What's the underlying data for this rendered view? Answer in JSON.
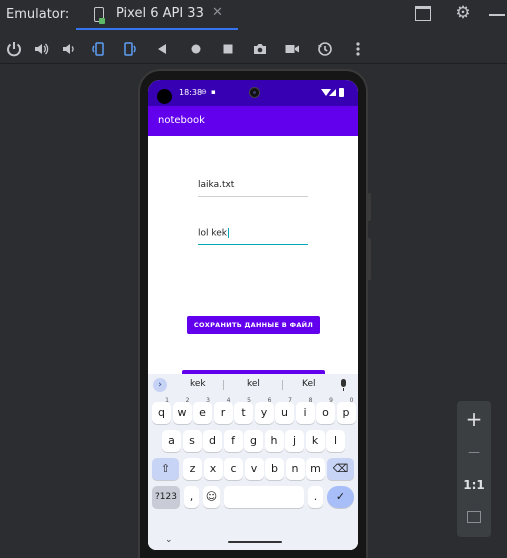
{
  "ide": {
    "panel_title": "Emulator:",
    "tab_title": "Pixel 6 API 33",
    "tab_close": "✕"
  },
  "toolbar": {
    "items": [
      "power-icon",
      "volume-up-icon",
      "volume-down-icon",
      "rotate-left-icon",
      "rotate-right-icon",
      "back-icon",
      "home-icon",
      "overview-icon",
      "screenshot-icon",
      "screen-record-icon",
      "snapshot-icon",
      "more-icon"
    ]
  },
  "device": {
    "status": {
      "time": "18:38"
    },
    "app": {
      "title": "notebook",
      "filename_value": "laika.txt",
      "content_value": "lol kek",
      "save_button": "СОХРАНИТЬ ДАННЫЕ В ФАЙЛ"
    },
    "keyboard": {
      "suggestions": [
        "kek",
        "kel",
        "Kel"
      ],
      "row1": [
        "q",
        "w",
        "e",
        "r",
        "t",
        "y",
        "u",
        "i",
        "o",
        "p"
      ],
      "row1_hints": [
        "1",
        "2",
        "3",
        "4",
        "5",
        "6",
        "7",
        "8",
        "9",
        "0"
      ],
      "row2": [
        "a",
        "s",
        "d",
        "f",
        "g",
        "h",
        "j",
        "k",
        "l"
      ],
      "row3": [
        "z",
        "x",
        "c",
        "v",
        "b",
        "n",
        "m"
      ],
      "symbols_key": "?123",
      "comma_key": ",",
      "period_key": ".",
      "emoji_key": "☺"
    }
  },
  "zoom": {
    "zoom_in": "+",
    "zoom_out": "—",
    "one_to_one": "1:1"
  },
  "colors": {
    "status_bar": "#3700b3",
    "app_bar": "#6200ee",
    "focus_underline": "#00a7b5"
  }
}
